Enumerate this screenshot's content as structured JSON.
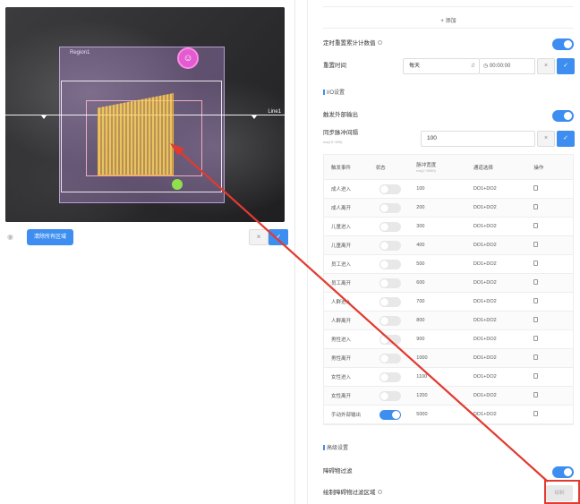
{
  "camera": {
    "region_label": "Region1",
    "line_label": "Line1"
  },
  "left_toolbar": {
    "clear_label": "清除所有区域",
    "cancel_icon": "×",
    "confirm_icon": "✓"
  },
  "right": {
    "add_label": "+ 添加",
    "timed_reset": {
      "label": "定时重置累计计数值",
      "enabled": true
    },
    "reset_time": {
      "label": "重置时间",
      "frequency": "每天",
      "time": "00:00:00"
    },
    "io_section": "I/O设置",
    "trigger_output": {
      "label": "触发外部输出",
      "enabled": true
    },
    "sync_interval": {
      "label": "同步脉冲间隔",
      "sublabel": "ms(10~500)",
      "value": "100"
    },
    "table": {
      "headers": [
        "触发事件",
        "状态",
        "脉冲宽度",
        "通道选择",
        "操作"
      ],
      "pulse_sub": "ms(1~5000)",
      "rows": [
        {
          "event": "成人进入",
          "on": false,
          "width": "100",
          "channel": "DO1+DO2"
        },
        {
          "event": "成人离开",
          "on": false,
          "width": "200",
          "channel": "DO1+DO2"
        },
        {
          "event": "儿童进入",
          "on": false,
          "width": "300",
          "channel": "DO1+DO2"
        },
        {
          "event": "儿童离开",
          "on": false,
          "width": "400",
          "channel": "DO1+DO2"
        },
        {
          "event": "员工进入",
          "on": false,
          "width": "500",
          "channel": "DO1+DO2"
        },
        {
          "event": "员工离开",
          "on": false,
          "width": "600",
          "channel": "DO1+DO2"
        },
        {
          "event": "人群进入",
          "on": false,
          "width": "700",
          "channel": "DO1+DO2"
        },
        {
          "event": "人群离开",
          "on": false,
          "width": "800",
          "channel": "DO1+DO2"
        },
        {
          "event": "男性进入",
          "on": false,
          "width": "900",
          "channel": "DO1+DO2"
        },
        {
          "event": "男性离开",
          "on": false,
          "width": "1000",
          "channel": "DO1+DO2"
        },
        {
          "event": "女性进入",
          "on": false,
          "width": "1100",
          "channel": "DO1+DO2"
        },
        {
          "event": "女性离开",
          "on": false,
          "width": "1200",
          "channel": "DO1+DO2"
        },
        {
          "event": "手动外部输出",
          "on": true,
          "width": "5000",
          "channel": "DO1+DO2"
        }
      ]
    },
    "advanced_section": "高级设置",
    "obstacle_filter": {
      "label": "障碍物过滤",
      "enabled": true
    },
    "draw_filter_area": {
      "label": "绘制障碍物过滤区域",
      "button": "绘制"
    }
  },
  "colors": {
    "accent": "#3d8ef0",
    "annotation_red": "#e23a2f"
  }
}
